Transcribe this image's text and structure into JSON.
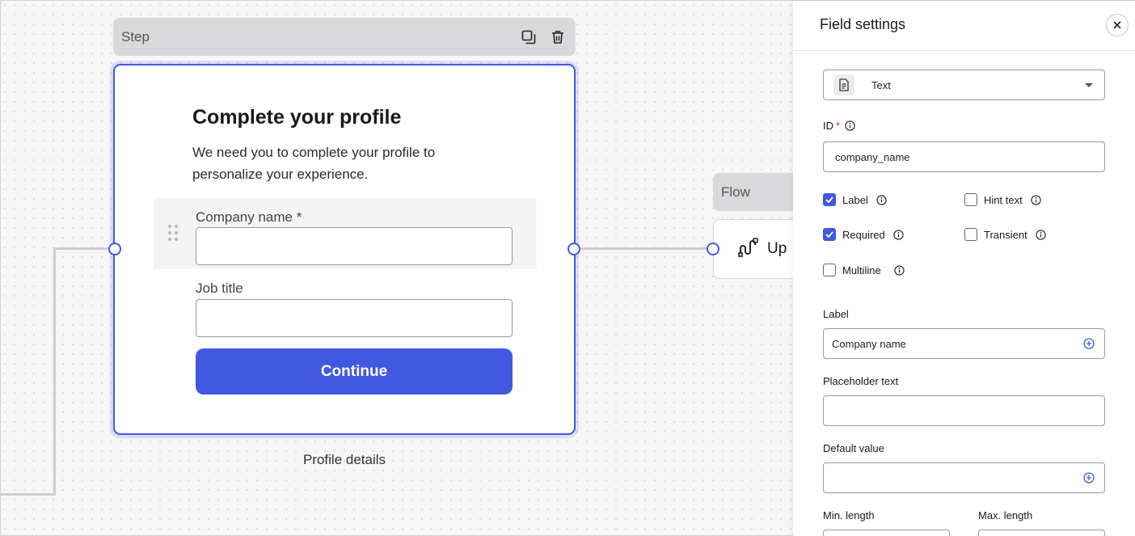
{
  "canvas": {
    "step": {
      "header_label": "Step",
      "title": "Complete your profile",
      "description": "We need you to complete your profile to personalize your experience.",
      "fields": [
        {
          "label": "Company name *",
          "value": ""
        },
        {
          "label": "Job title",
          "value": ""
        }
      ],
      "button_label": "Continue",
      "caption": "Profile details"
    },
    "flow": {
      "header_label": "Flow",
      "title": "Up"
    }
  },
  "panel": {
    "title": "Field settings",
    "type_select": {
      "value": "Text",
      "icon": "document-icon"
    },
    "id_field": {
      "label": "ID",
      "value": "company_name"
    },
    "checkboxes": [
      {
        "label": "Label",
        "checked": true
      },
      {
        "label": "Hint text",
        "checked": false
      },
      {
        "label": "Required",
        "checked": true
      },
      {
        "label": "Transient",
        "checked": false
      },
      {
        "label": "Multiline",
        "checked": false
      }
    ],
    "label_field": {
      "label": "Label",
      "value": "Company name"
    },
    "placeholder_field": {
      "label": "Placeholder text",
      "value": ""
    },
    "default_field": {
      "label": "Default value",
      "value": ""
    },
    "min_length": {
      "label": "Min. length"
    },
    "max_length": {
      "label": "Max. length"
    }
  },
  "colors": {
    "accent": "#4158e0",
    "header_gray": "#d9d9dc"
  }
}
